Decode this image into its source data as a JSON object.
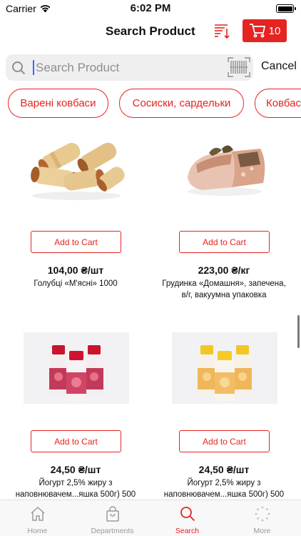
{
  "status_bar": {
    "carrier": "Carrier",
    "time": "6:02 PM"
  },
  "header": {
    "title": "Search Product",
    "cart_count": "10"
  },
  "search": {
    "placeholder": "Search Product",
    "value": "",
    "cancel_label": "Cancel"
  },
  "categories": [
    {
      "label": "Варені ковбаси"
    },
    {
      "label": "Сосиски, сардельки"
    },
    {
      "label": "Ковбаси"
    }
  ],
  "products": [
    {
      "add_label": "Add to Cart",
      "price": "104,00 ₴/шт",
      "name_line1": "Голубці «М'ясні» 1000",
      "name_line2": ""
    },
    {
      "add_label": "Add to Cart",
      "price": "223,00 ₴/кг",
      "name_line1": "Грудинка «Домашня», запечена,",
      "name_line2": "в/г, вакуумна упаковка"
    },
    {
      "add_label": "Add to Cart",
      "price": "24,50 ₴/шт",
      "name_line1": "Йогурт 2,5% жиру з",
      "name_line2": "наповнювачем...яшка 500г) 500"
    },
    {
      "add_label": "Add to Cart",
      "price": "24,50 ₴/шт",
      "name_line1": "Йогурт 2,5% жиру з",
      "name_line2": "наповнювачем...яшка 500г) 500"
    }
  ],
  "tabs": [
    {
      "label": "Home",
      "icon": "home-icon"
    },
    {
      "label": "Departments",
      "icon": "bag-icon"
    },
    {
      "label": "Search",
      "icon": "search-icon"
    },
    {
      "label": "More",
      "icon": "more-icon"
    }
  ],
  "colors": {
    "accent": "#e52421",
    "tab_inactive": "#9a9a9a",
    "search_bg": "#efeff0"
  }
}
